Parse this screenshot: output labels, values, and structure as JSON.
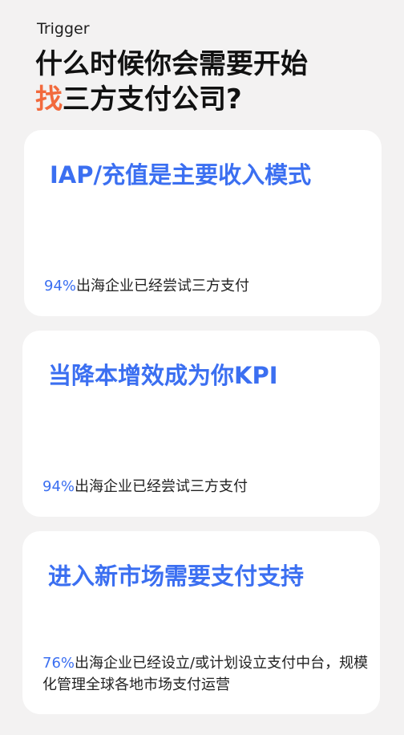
{
  "header": {
    "eyebrow": "Trigger",
    "title_line1": "什么时候你会需要开始",
    "title_accent": "找",
    "title_line2_rest": "三方支付公司?"
  },
  "colors": {
    "accent_orange": "#f26a3d",
    "accent_blue": "#3b6ff1",
    "background": "#f3f2f2",
    "card": "#ffffff"
  },
  "cards": [
    {
      "heading": "IAP/充值是主要收入模式",
      "percent": "94%",
      "note": "出海企业已经尝试三方支付"
    },
    {
      "heading": "当降本增效成为你KPI",
      "percent": "94%",
      "note": "出海企业已经尝试三方支付"
    },
    {
      "heading": "进入新市场需要支付支持",
      "percent": "76%",
      "note": "出海企业已经设立/或计划设立支付中台，规模化管理全球各地市场支付运营"
    }
  ]
}
